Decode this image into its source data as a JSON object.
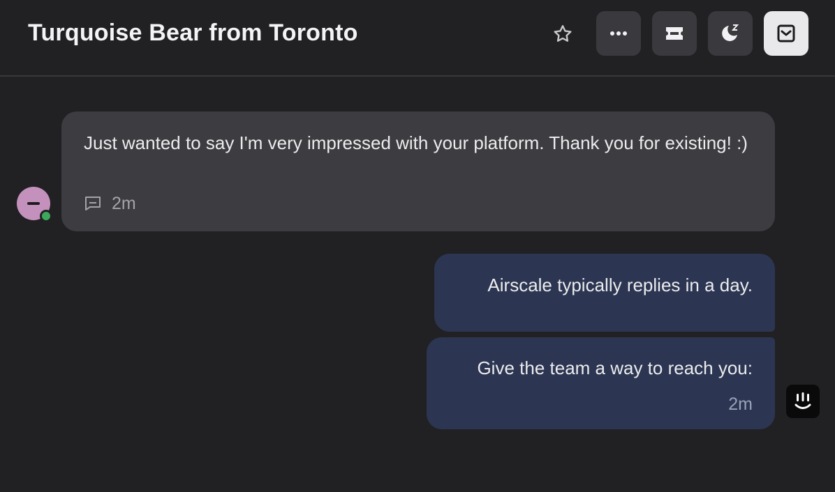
{
  "header": {
    "title": "Turquoise Bear from Toronto",
    "buttons": [
      {
        "name": "star-icon"
      },
      {
        "name": "more-icon"
      },
      {
        "name": "ticket-icon"
      },
      {
        "name": "snooze-icon"
      },
      {
        "name": "inbox-close-icon"
      }
    ]
  },
  "conversation": {
    "user_message": {
      "text": "Just wanted to say I'm very impressed with your platform. Thank you for existing! :)",
      "time": "2m",
      "icon": "conversation-icon"
    },
    "bot_messages": [
      {
        "text": "Airscale typically replies in a day."
      },
      {
        "text": "Give the team a way to reach you:",
        "time": "2m"
      }
    ]
  },
  "colors": {
    "background": "#212123",
    "user_bubble": "#3d3d41",
    "bot_bubble": "#2c3652",
    "online": "#3ca85b",
    "avatar": "#c491bd"
  }
}
